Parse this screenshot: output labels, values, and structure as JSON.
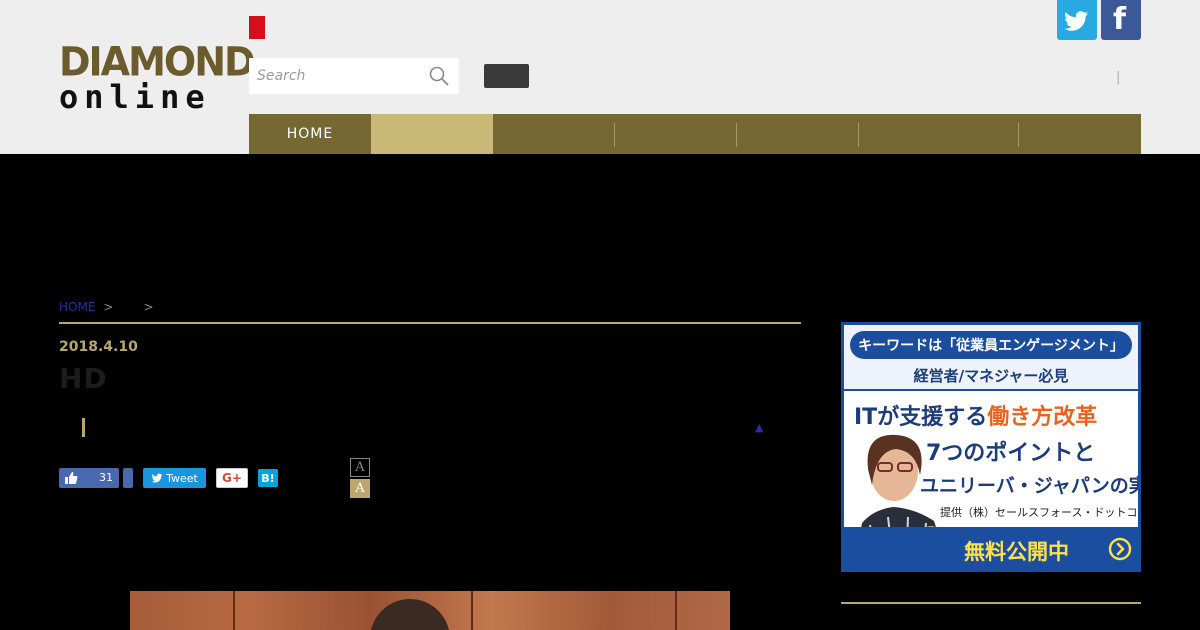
{
  "header": {
    "logo": {
      "line1": "DIAMOND",
      "line2": "online"
    },
    "search": {
      "placeholder": "Search"
    },
    "social": {
      "twitter_icon": "twitter-icon",
      "facebook_icon": "facebook-icon",
      "facebook_glyph": "f"
    },
    "divider_text": "|"
  },
  "nav": {
    "items": [
      {
        "label": "HOME"
      },
      {
        "label": ""
      },
      {
        "label": ""
      },
      {
        "label": ""
      },
      {
        "label": ""
      },
      {
        "label": ""
      },
      {
        "label": ""
      }
    ]
  },
  "breadcrumb": {
    "home": "HOME",
    "sep1": ">",
    "sep2": ">"
  },
  "article": {
    "date": "2018.4.10",
    "title": "HD",
    "scroll_marker": "▲"
  },
  "share": {
    "like_count": "31",
    "tweet_label": "Tweet",
    "gplus_label": "G+",
    "hatena_label": "B!",
    "font_small": "A",
    "font_large": "A"
  },
  "ad": {
    "pill": "キーワードは「従業員エンゲージメント」",
    "sub": "経営者/マネジャー必見",
    "headline1_a": "ITが支援する",
    "headline1_b": "働き方改革",
    "headline2": "7つのポイントと",
    "headline3": "ユニリーバ・ジャパンの実践",
    "provider": "提供（株）セールスフォース・ドットコム",
    "cta": "無料公開中"
  },
  "colors": {
    "gold": "#bba76b",
    "nav_bg": "#766832",
    "nav_active": "#c9b878",
    "ad_blue": "#1c4ea0",
    "ad_orange": "#e8641e"
  }
}
